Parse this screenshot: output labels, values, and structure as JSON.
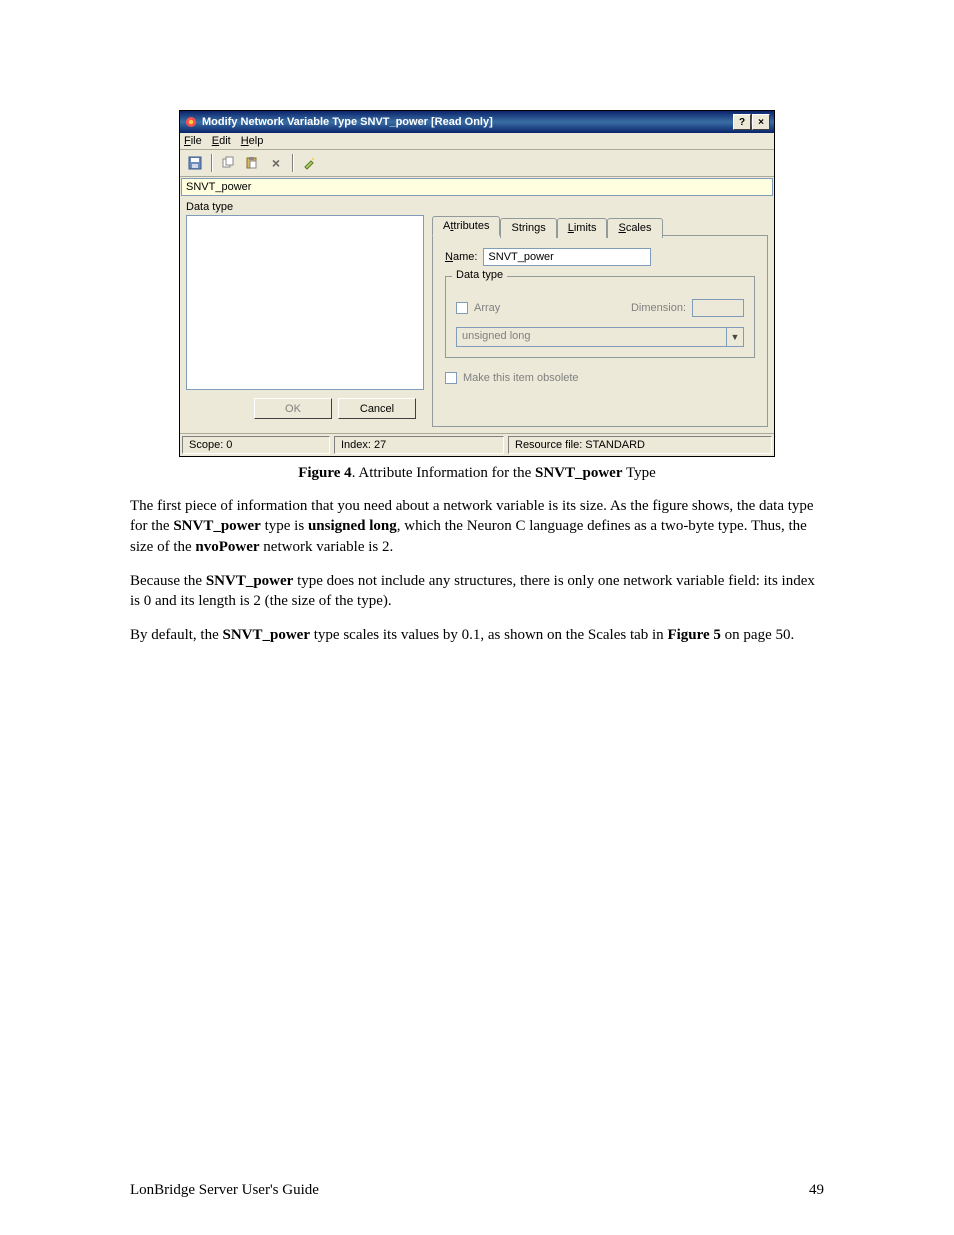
{
  "window": {
    "title": "Modify Network Variable Type SNVT_power [Read Only]",
    "menus": {
      "file": "File",
      "edit": "Edit",
      "help": "Help"
    },
    "name_field": "SNVT_power",
    "left_label": "Data type",
    "buttons": {
      "ok": "OK",
      "cancel": "Cancel"
    },
    "tabs": {
      "attributes": "Attributes",
      "strings": "Strings",
      "limits": "Limits",
      "scales": "Scales"
    },
    "attr_panel": {
      "name_label": "Name:",
      "name_value": "SNVT_power",
      "group_label": "Data type",
      "array_label": "Array",
      "dimension_label": "Dimension:",
      "dimension_value": "",
      "type_select": "unsigned long",
      "obsolete_label": "Make this item obsolete"
    },
    "status": {
      "scope": "Scope: 0",
      "index": "Index: 27",
      "resource": "Resource file: STANDARD"
    }
  },
  "caption": {
    "fig_label": "Figure 4",
    "rest": ". Attribute Information for the ",
    "type": "SNVT_power",
    "tail": " Type"
  },
  "paras": {
    "p1a": "The first piece of information that you need about a network variable is its size. As the figure shows, the data type for the ",
    "p1b": "SNVT_power",
    "p1c": " type is ",
    "p1d": "unsigned long",
    "p1e": ", which the Neuron C language defines as a two-byte type.  Thus, the size of the ",
    "p1f": "nvoPower",
    "p1g": " network variable is 2.",
    "p2a": "Because the ",
    "p2b": "SNVT_power",
    "p2c": " type does not include any structures, there is only one network variable field:  its index is 0 and its length is 2 (the size of the type).",
    "p3a": "By default, the ",
    "p3b": "SNVT_power",
    "p3c": " type scales its values by 0.1, as shown on the Scales tab in ",
    "p3d": "Figure 5",
    "p3e": " on page 50."
  },
  "footer": {
    "left": "LonBridge Server User's Guide",
    "right": "49"
  }
}
